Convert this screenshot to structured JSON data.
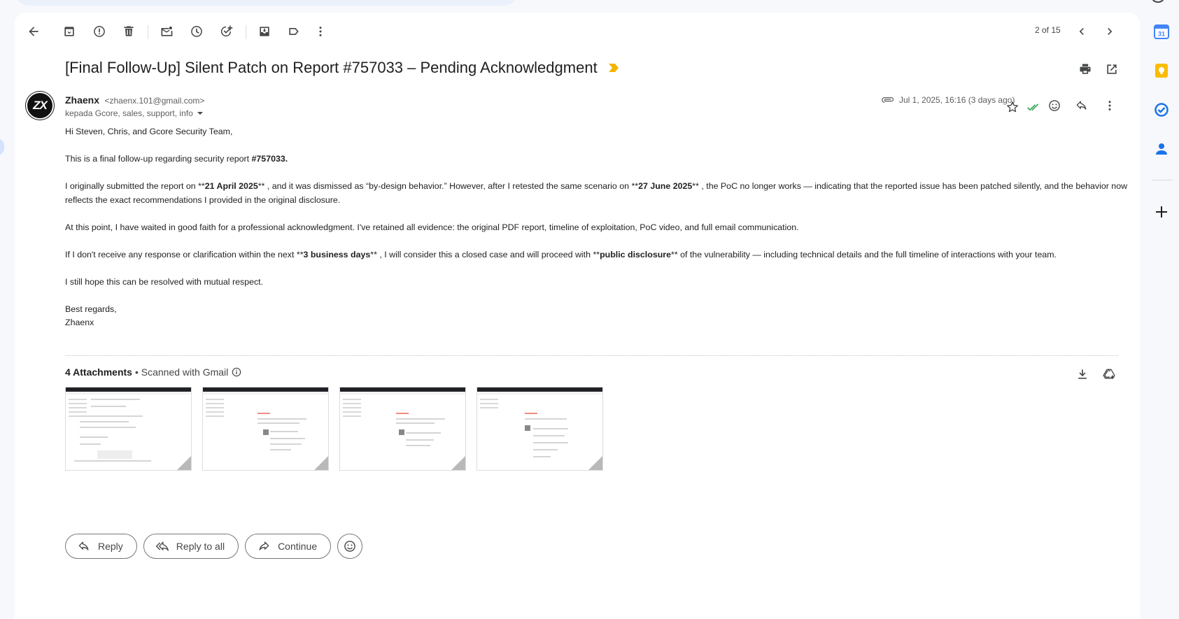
{
  "toolbar": {
    "back": "arrow-back-icon",
    "pager": "2 of 15"
  },
  "message": {
    "subject": "[Final Follow-Up] Silent Patch on Report #757033 – Pending Acknowledgment",
    "sender_name": "Zhaenx",
    "sender_email": "<zhaenx.101@gmail.com>",
    "recipients": "kepada Gcore, sales, support, info",
    "date": "Jul 1, 2025, 16:16 (3 days ago)",
    "avatar_text": "ZX"
  },
  "body": {
    "greeting": "Hi Steven, Chris, and Gcore Security Team,",
    "p1_prefix": "This is a final follow-up regarding security report ",
    "p1_bold": "#757033.",
    "p2_a": "I originally submitted the report on **",
    "p2_b": "21 April 2025",
    "p2_c": "** , and it was dismissed as “by-design behavior.” However, after I retested the same scenario on **",
    "p2_d": "27 June 2025",
    "p2_e": "** , the PoC no longer works — indicating that the reported issue has been patched silently, and the behavior now reflects the exact recommendations I provided in the original disclosure.",
    "p3": "At this point, I have waited in good faith for a professional acknowledgment. I've retained all evidence: the original PDF report, timeline of exploitation, PoC video, and full email communication.",
    "p4_a": "If I don't receive any response or clarification within the next **",
    "p4_b": "3 business days",
    "p4_c": "** , I will consider this a closed case and will proceed with **",
    "p4_d": "public disclosure",
    "p4_e": "** of the vulnerability — including technical details and the full timeline of interactions with your team.",
    "p5": "I still hope this can be resolved with mutual respect.",
    "closing": "Best regards,",
    "signature": "Zhaenx"
  },
  "attachments": {
    "count_label": "4 Attachments",
    "scanned_label": "• Scanned with Gmail",
    "items": [
      "screenshot-1",
      "screenshot-2",
      "screenshot-3",
      "screenshot-4"
    ]
  },
  "actions": {
    "reply": "Reply",
    "reply_all": "Reply to all",
    "forward": "Continue"
  },
  "colors": {
    "accent_yellow": "#f4b400",
    "check_green": "#34a853",
    "calendar_blue": "#4285f4",
    "keep_yellow": "#fbbc04"
  }
}
